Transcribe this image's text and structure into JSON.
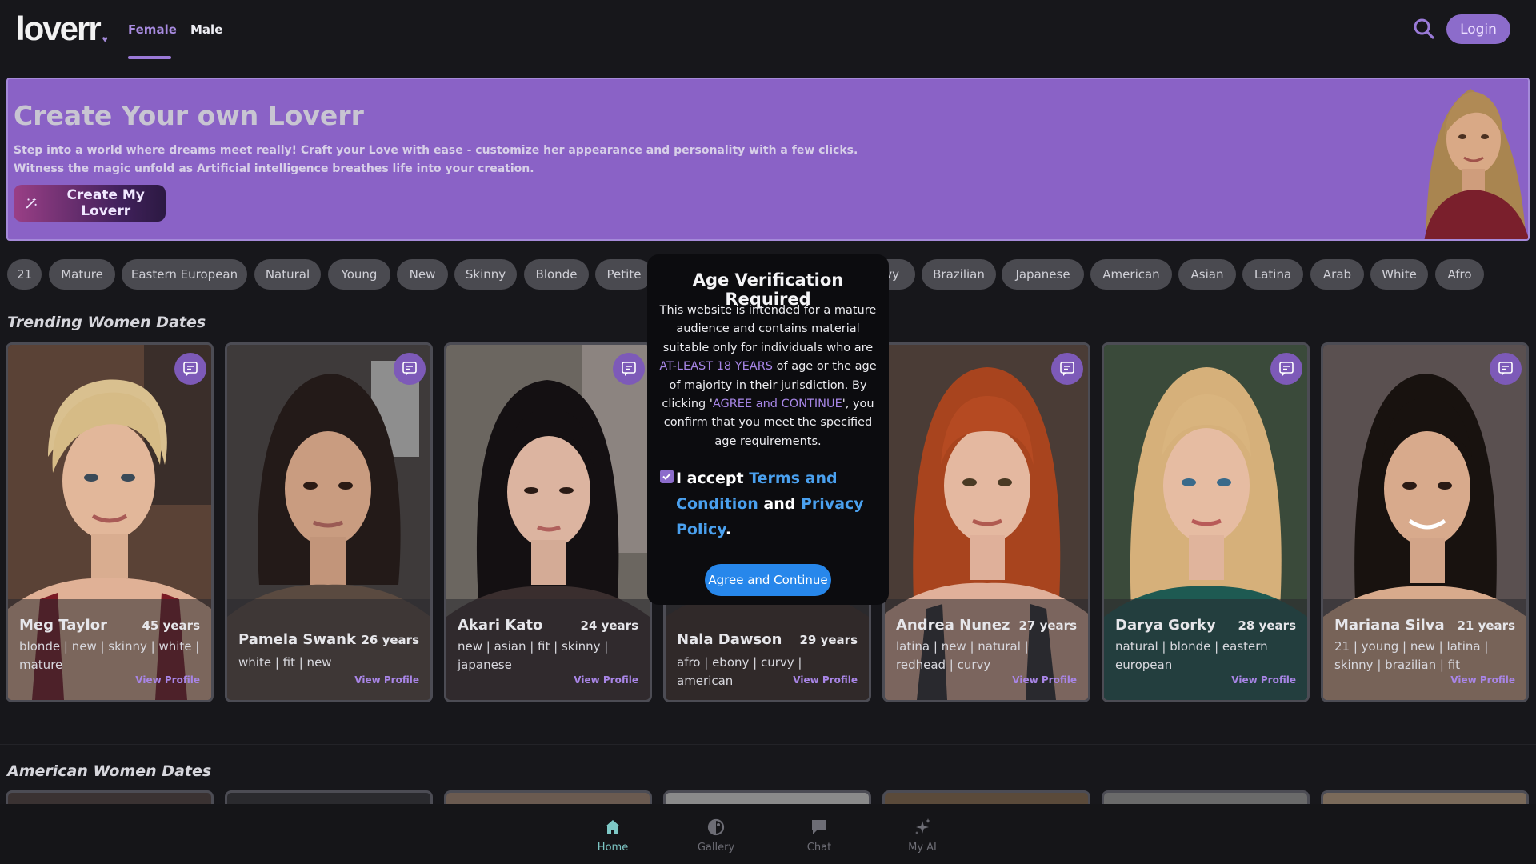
{
  "header": {
    "logo": "loverr",
    "tabs": [
      {
        "label": "Female",
        "active": true
      },
      {
        "label": "Male",
        "active": false
      }
    ],
    "login_label": "Login"
  },
  "banner": {
    "title": "Create Your own Loverr",
    "desc_line1": "Step into a world where dreams meet really! Craft your Love with ease - customize her appearance and personality with a few clicks.",
    "desc_line2": "Witness the magic unfold as Artificial intelligence breathes life into your creation.",
    "button_label": "Create My Loverr"
  },
  "tags": [
    "21",
    "Mature",
    "Eastern European",
    "Natural",
    "Young",
    "New",
    "Skinny",
    "Blonde",
    "Petite",
    "Curvy",
    "Brazilian",
    "Japanese",
    "American",
    "Asian",
    "Latina",
    "Arab",
    "White",
    "Afro"
  ],
  "sections": {
    "trending": "Trending Women Dates",
    "american": "American Women Dates"
  },
  "cards": [
    {
      "name": "Meg Taylor",
      "age": "45 years",
      "tags": "blonde | new | skinny | white | mature",
      "link": "View Profile"
    },
    {
      "name": "Pamela Swank",
      "age": "26 years",
      "tags": "white | fit | new",
      "link": "View Profile"
    },
    {
      "name": "Akari Kato",
      "age": "24 years",
      "tags": "new | asian | fit | skinny | japanese",
      "link": "View Profile"
    },
    {
      "name": "Nala Dawson",
      "age": "29 years",
      "tags": "afro | ebony | curvy | american",
      "link": "View Profile"
    },
    {
      "name": "Andrea Nunez",
      "age": "27 years",
      "tags": "latina | new | natural | redhead | curvy",
      "link": "View Profile"
    },
    {
      "name": "Darya Gorky",
      "age": "28 years",
      "tags": "natural | blonde | eastern european",
      "link": "View Profile"
    },
    {
      "name": "Mariana Silva",
      "age": "21 years",
      "tags": "21 | young | new | latina | skinny | brazilian | fit",
      "link": "View Profile"
    }
  ],
  "modal": {
    "title": "Age Verification Required",
    "body_1": "This website is intended for a mature audience and contains material suitable only for individuals who are ",
    "body_highlight_1": "AT-LEAST 18 YEARS",
    "body_2": " of age or the age of majority in their jurisdiction. By clicking '",
    "body_highlight_2": "AGREE and CONTINUE",
    "body_3": "', you confirm that you meet the specified age requirements.",
    "accept_prefix": "I accept ",
    "terms_link": "Terms and Condition",
    "and_text": " and ",
    "privacy_link": "Privacy Policy",
    "period": ".",
    "checkbox_checked": true,
    "button_label": "Agree and Continue"
  },
  "bottom_nav": [
    {
      "label": "Home",
      "icon": "home-icon",
      "active": true
    },
    {
      "label": "Gallery",
      "icon": "gallery-icon",
      "active": false
    },
    {
      "label": "Chat",
      "icon": "chat-icon",
      "active": false
    },
    {
      "label": "My AI",
      "icon": "sparkle-icon",
      "active": false
    }
  ],
  "colors": {
    "accent": "#8c6ccb",
    "banner": "#8a62c6",
    "link_purple": "#a885e6",
    "link_blue": "#4aa0ee",
    "button_blue": "#2787eb",
    "home_active": "#7ec8c6"
  }
}
